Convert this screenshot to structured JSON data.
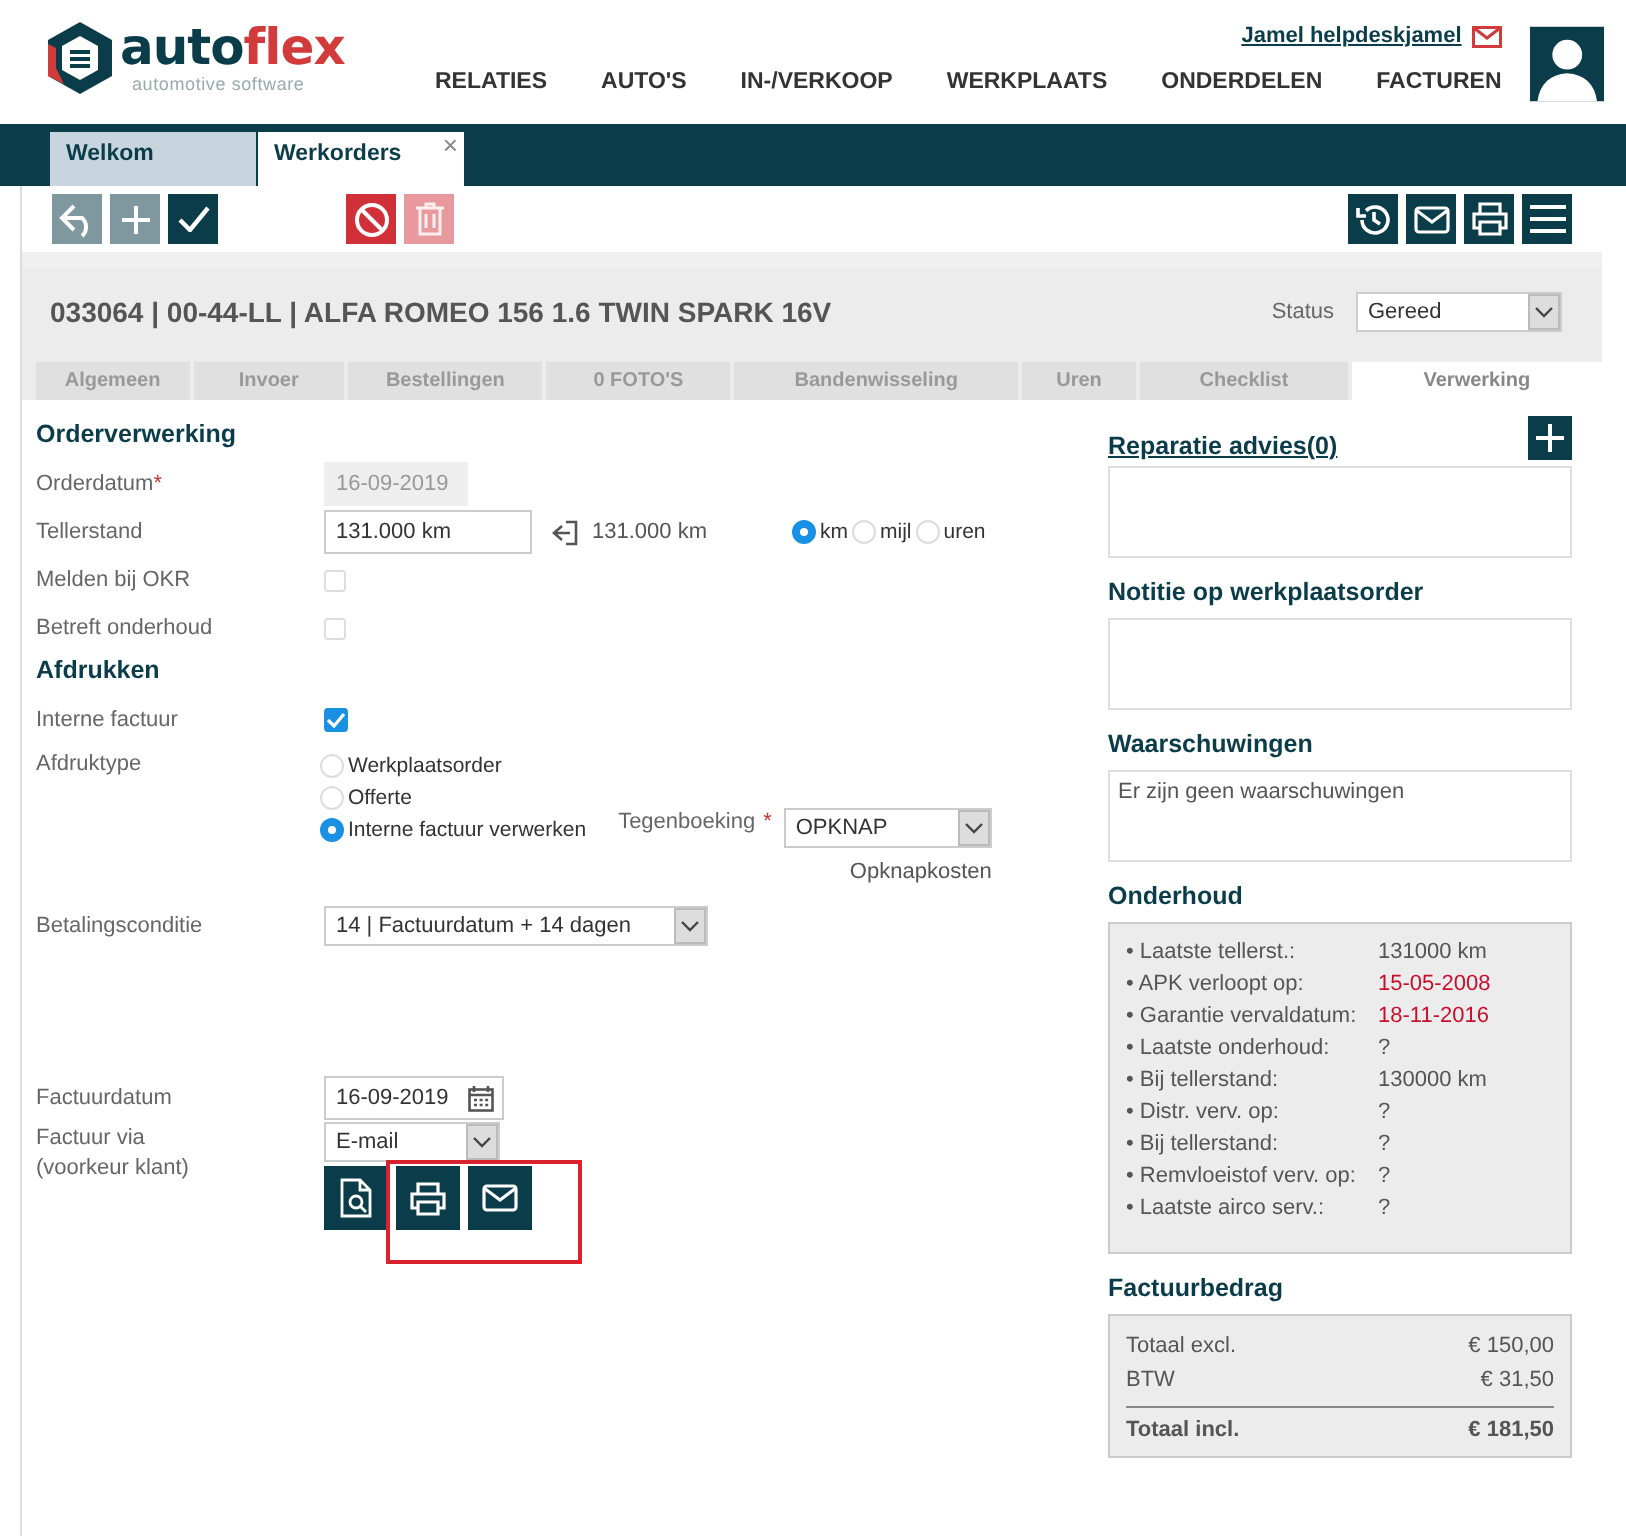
{
  "logo": {
    "main": "auto",
    "accent": "flex",
    "tagline": "automotive software"
  },
  "user": {
    "name": "Jamel helpdeskjamel"
  },
  "nav": [
    "RELATIES",
    "AUTO'S",
    "IN-/VERKOOP",
    "WERKPLAATS",
    "ONDERDELEN",
    "FACTUREN"
  ],
  "tabs": [
    {
      "label": "Welkom",
      "selected": false
    },
    {
      "label": "Werkorders",
      "selected": true,
      "close": "×"
    }
  ],
  "toolbar": {
    "left": [
      {
        "kind": "back",
        "color": "#7f979f",
        "disabled": false
      },
      {
        "kind": "add",
        "color": "#7f979f",
        "disabled": false
      },
      {
        "kind": "confirm",
        "color": "#0b3c49",
        "disabled": false
      },
      {
        "kind": "cancel",
        "color": "#d23038",
        "disabled": false
      },
      {
        "kind": "delete",
        "color": "#e8999d",
        "disabled": true
      }
    ],
    "right": [
      {
        "kind": "history",
        "color": "#0b3c49",
        "disabled": false
      },
      {
        "kind": "mail",
        "color": "#0b3c49",
        "disabled": false
      },
      {
        "kind": "print",
        "color": "#0b3c49",
        "disabled": false
      },
      {
        "kind": "menu",
        "color": "#0b3c49",
        "disabled": false
      }
    ]
  },
  "order": {
    "title": "033064 | 00-44-LL | ALFA ROMEO 156 1.6 TWIN SPARK 16V",
    "status_label": "Status",
    "status": "Gereed"
  },
  "section_tabs": [
    {
      "label": "Algemeen",
      "selected": false
    },
    {
      "label": "Invoer",
      "selected": false
    },
    {
      "label": "Bestellingen",
      "selected": false
    },
    {
      "label": "0 FOTO'S",
      "selected": false
    },
    {
      "label": "Bandenwisseling",
      "selected": false
    },
    {
      "label": "Uren",
      "selected": false
    },
    {
      "label": "Checklist",
      "selected": false
    },
    {
      "label": "Verwerking",
      "selected": true
    }
  ],
  "order_processing": {
    "heading": "Orderverwerking",
    "fields": [
      {
        "kind": "date",
        "label": "Orderdatum",
        "required_mark": "*",
        "value": "16-09-2019",
        "disabled": true
      },
      {
        "kind": "odometer",
        "label": "Tellerstand",
        "value": "131.000 km",
        "reading": "131.000 km",
        "units": [
          {
            "label": "km",
            "selected": true
          },
          {
            "label": "mijl",
            "selected": false
          },
          {
            "label": "uren",
            "selected": false
          }
        ]
      },
      {
        "kind": "checkbox",
        "label": "Melden bij OKR",
        "checked": false
      },
      {
        "kind": "checkbox",
        "label": "Betreft onderhoud",
        "checked": false
      }
    ]
  },
  "printing": {
    "heading": "Afdrukken",
    "internal_invoice": {
      "label": "Interne factuur",
      "checked": true
    },
    "print_type": {
      "label": "Afdruktype",
      "options": [
        {
          "label": "Werkplaatsorder",
          "selected": false
        },
        {
          "label": "Offerte",
          "selected": false
        },
        {
          "label": "Interne factuur verwerken",
          "selected": true
        }
      ]
    },
    "counter_booking": {
      "label": "Tegenboeking",
      "required_mark": "*",
      "value": "OPKNAP",
      "note": "Opknapkosten"
    }
  },
  "payment": {
    "label": "Betalingsconditie",
    "value": "14 | Factuurdatum + 14 dagen"
  },
  "invoice_date": {
    "label": "Factuurdatum",
    "value": "16-09-2019"
  },
  "invoice_via": {
    "label": "Factuur via",
    "hint": "(voorkeur klant)",
    "value": "E-mail"
  },
  "output_actions": [
    {
      "kind": "preview"
    },
    {
      "kind": "print"
    },
    {
      "kind": "mail"
    }
  ],
  "highlight_frame": true,
  "repair_advice": {
    "title": "Reparatie advies(0)"
  },
  "note": {
    "title": "Notitie op werkplaatsorder"
  },
  "warnings": {
    "title": "Waarschuwingen",
    "text": "Er zijn geen waarschuwingen"
  },
  "maintenance": {
    "title": "Onderhoud",
    "rows": [
      {
        "label": "• Laatste tellerst.:",
        "value": "131000 km",
        "alert": false
      },
      {
        "label": "• APK verloopt op:",
        "value": "15-05-2008",
        "alert": true
      },
      {
        "label": "• Garantie vervaldatum:",
        "value": "18-11-2016",
        "alert": true
      },
      {
        "label": "• Laatste onderhoud:",
        "value": "?",
        "alert": false
      },
      {
        "label": "• Bij tellerstand:",
        "value": "130000 km",
        "alert": false
      },
      {
        "label": "• Distr. verv. op:",
        "value": "?",
        "alert": false
      },
      {
        "label": "• Bij tellerstand:",
        "value": "?",
        "alert": false
      },
      {
        "label": "• Remvloeistof verv. op:",
        "value": "?",
        "alert": false
      },
      {
        "label": "• Laatste airco serv.:",
        "value": "?",
        "alert": false
      }
    ]
  },
  "invoice_amount": {
    "title": "Factuurbedrag",
    "rows": [
      {
        "label": "Totaal excl.",
        "value": "€ 150,00",
        "total": false
      },
      {
        "label": "BTW",
        "value": "€ 31,50",
        "total": false
      },
      {
        "label": "Totaal incl.",
        "value": "€ 181,50",
        "total": true
      }
    ]
  }
}
